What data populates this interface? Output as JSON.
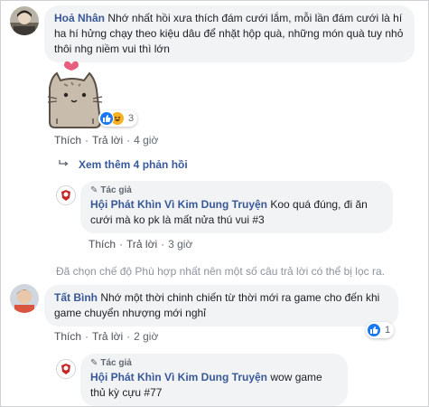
{
  "comments": [
    {
      "author": "Hoả Nhân",
      "text": "Nhớ nhất hồi xưa thích đám cưới lắm, mỗi lần đám cưới là hí ha hí hửng chạy theo kiệu dâu để nhặt hộp quà, những món quà tuy nhỏ thôi nhg niềm vui thì lớn",
      "reaction_count": "3",
      "like_label": "Thích",
      "reply_label": "Trả lời",
      "time": "4 giờ",
      "more_replies": "Xem thêm 4 phản hồi",
      "reply": {
        "author_tag": "Tác giả",
        "author": "Hội Phát Khìn Vì Kim Dung Truyện",
        "text": "Koo quá đúng, đi ăn cưới mà ko pk là mất nửa thú vui #3",
        "like_label": "Thích",
        "reply_label": "Trả lời",
        "time": "3 giờ"
      }
    },
    {
      "author": "Tất Bình",
      "text": "Nhớ một thời chinh chiến từ thời mới ra game cho đến khi game chuyển nhượng mới nghỉ",
      "reaction_count": "1",
      "like_label": "Thích",
      "reply_label": "Trả lời",
      "time": "2 giờ",
      "reply": {
        "author_tag": "Tác giả",
        "author": "Hội Phát Khìn Vì Kim Dung Truyện",
        "text": "wow game thủ kỳ cựu #77"
      }
    }
  ],
  "filter_notice": "Đã chọn chế độ Phù hợp nhất nên một số câu trả lời có thể bị lọc ra.",
  "colors": {
    "link": "#385898",
    "bubble": "#f2f3f5",
    "like": "#1877f2",
    "muted": "#606770"
  },
  "icons": [
    "avatar-hoa-nhan",
    "pusheen-cat-sticker",
    "like-reaction-icon",
    "haha-reaction-icon",
    "reply-arrow-icon",
    "page-avatar-icon",
    "pen-icon",
    "avatar-tat-binh"
  ]
}
